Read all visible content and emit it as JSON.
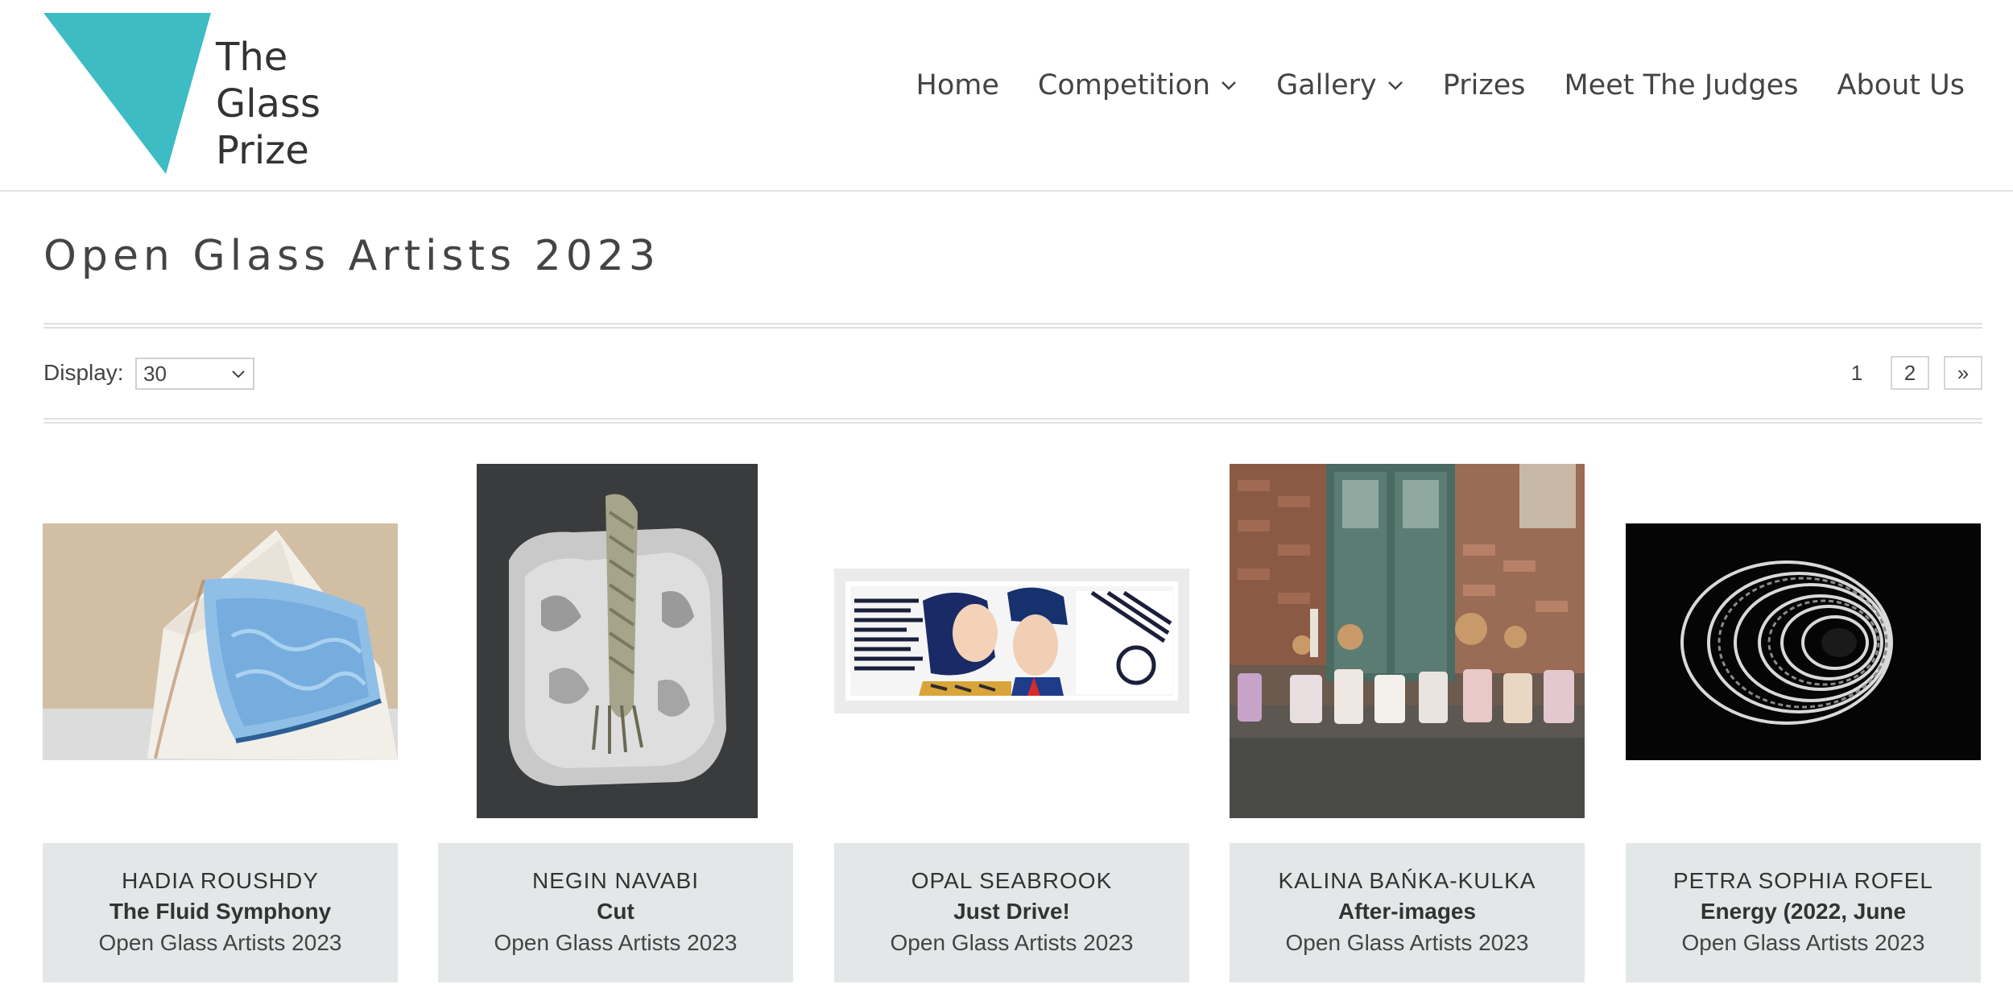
{
  "logo": {
    "line1": "The",
    "line2": "Glass",
    "line3": "Prize",
    "color": "#3dbcc4"
  },
  "nav": {
    "home": "Home",
    "competition": "Competition",
    "gallery": "Gallery",
    "prizes": "Prizes",
    "judges": "Meet The Judges",
    "about": "About Us"
  },
  "page": {
    "title": "Open Glass Artists 2023"
  },
  "display": {
    "label": "Display:",
    "selected": "30"
  },
  "pagination": {
    "current": "1",
    "next_page": "2",
    "next_arrow": "»"
  },
  "artworks": [
    {
      "artist": "HADIA ROUSHDY",
      "title": "The Fluid Symphony",
      "collection": "Open Glass Artists 2023"
    },
    {
      "artist": "NEGIN NAVABI",
      "title": "Cut",
      "collection": "Open Glass Artists 2023"
    },
    {
      "artist": "OPAL SEABROOK",
      "title": "Just Drive!",
      "collection": "Open Glass Artists 2023"
    },
    {
      "artist": "KALINA BAŃKA-KULKA",
      "title": "After-images",
      "collection": "Open Glass Artists 2023"
    },
    {
      "artist": "PETRA SOPHIA ROFEL",
      "title": "Energy (2022, June",
      "collection": "Open Glass Artists 2023"
    }
  ],
  "colors": {
    "accent": "#3dbcc4",
    "caption_bg": "#e3e7e8",
    "text": "#333333"
  }
}
